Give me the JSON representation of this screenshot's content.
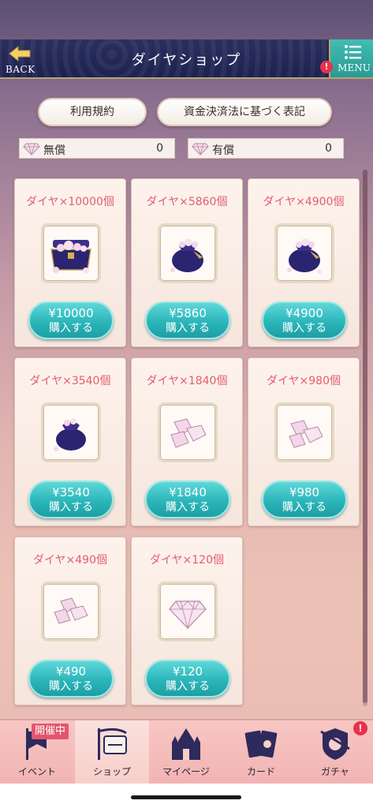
{
  "header": {
    "back_label": "BACK",
    "title": "ダイヤショップ",
    "menu_label": "MENU",
    "menu_badge": "!"
  },
  "links": {
    "terms": "利用規約",
    "payment_law": "資金決済法に基づく表記"
  },
  "balances": {
    "free": {
      "label": "無償",
      "value": "0"
    },
    "paid": {
      "label": "有償",
      "value": "0"
    }
  },
  "products": [
    {
      "title": "ダイヤ×10000個",
      "price": "¥10000",
      "buy": "購入する",
      "image": "treasure-chest-icon"
    },
    {
      "title": "ダイヤ×5860個",
      "price": "¥5860",
      "buy": "購入する",
      "image": "gem-bag-icon"
    },
    {
      "title": "ダイヤ×4900個",
      "price": "¥4900",
      "buy": "購入する",
      "image": "gem-bag-icon"
    },
    {
      "title": "ダイヤ×3540個",
      "price": "¥3540",
      "buy": "購入する",
      "image": "gem-bag-icon"
    },
    {
      "title": "ダイヤ×1840個",
      "price": "¥1840",
      "buy": "購入する",
      "image": "gem-pile-icon"
    },
    {
      "title": "ダイヤ×980個",
      "price": "¥980",
      "buy": "購入する",
      "image": "gem-pile-icon"
    },
    {
      "title": "ダイヤ×490個",
      "price": "¥490",
      "buy": "購入する",
      "image": "gem-pile-icon"
    },
    {
      "title": "ダイヤ×120個",
      "price": "¥120",
      "buy": "購入する",
      "image": "single-diamond-icon"
    }
  ],
  "nav": {
    "event": {
      "label": "イベント",
      "badge": "開催中"
    },
    "shop": {
      "label": "ショップ"
    },
    "mypage": {
      "label": "マイページ"
    },
    "card": {
      "label": "カード"
    },
    "gacha": {
      "label": "ガチャ",
      "badge": "!"
    }
  },
  "colors": {
    "header_bg": "#1d2250",
    "menu_teal": "#2b9a92",
    "buy_teal": "#2bb6ba",
    "title_pink": "#e35c72",
    "badge_red": "#e8314d"
  }
}
